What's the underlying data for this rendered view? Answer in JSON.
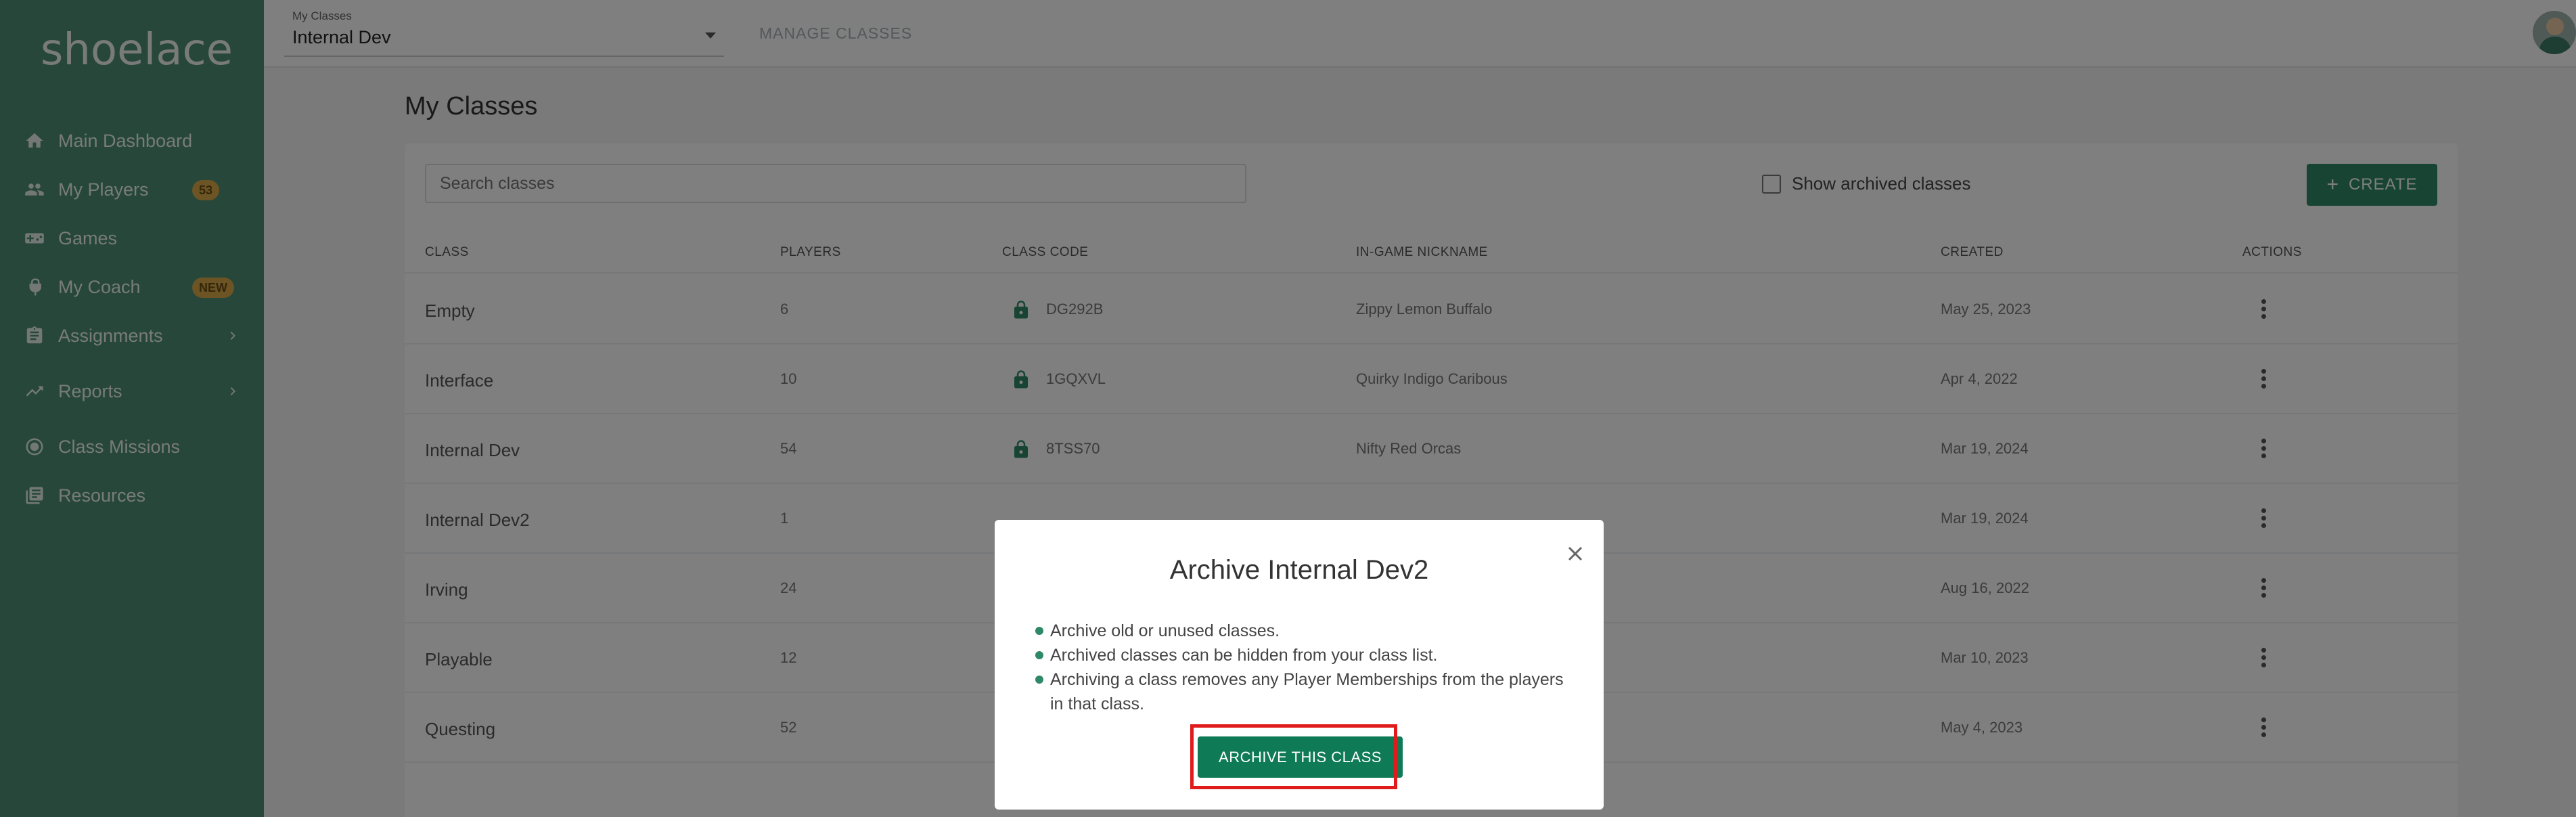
{
  "sidebar": {
    "logo": "shoelace",
    "items": [
      {
        "label": "Main Dashboard",
        "icon": "home-icon"
      },
      {
        "label": "My Players",
        "icon": "people-icon",
        "badge": "53"
      },
      {
        "label": "Games",
        "icon": "gamepad-icon"
      },
      {
        "label": "My Coach",
        "icon": "coach-icon",
        "badge": "NEW"
      },
      {
        "label": "Assignments",
        "icon": "clipboard-icon",
        "chevron": true
      },
      {
        "label": "Reports",
        "icon": "trend-icon",
        "chevron": true
      },
      {
        "label": "Class Missions",
        "icon": "target-icon"
      },
      {
        "label": "Resources",
        "icon": "library-icon"
      }
    ]
  },
  "topbar": {
    "class_select_label": "My Classes",
    "class_select_value": "Internal Dev",
    "manage_link": "MANAGE CLASSES"
  },
  "main": {
    "title": "My Classes",
    "search_placeholder": "Search classes",
    "show_archived_label": "Show archived classes",
    "create_label": "CREATE",
    "columns": [
      "CLASS",
      "PLAYERS",
      "CLASS CODE",
      "IN-GAME NICKNAME",
      "CREATED",
      "ACTIONS"
    ],
    "rows": [
      {
        "class": "Empty",
        "players": "6",
        "code": "DG292B",
        "nickname": "Zippy Lemon Buffalo",
        "created": "May 25, 2023"
      },
      {
        "class": "Interface",
        "players": "10",
        "code": "1GQXVL",
        "nickname": "Quirky Indigo Caribous",
        "created": "Apr 4, 2022"
      },
      {
        "class": "Internal Dev",
        "players": "54",
        "code": "8TSS70",
        "nickname": "Nifty Red Orcas",
        "created": "Mar 19, 2024"
      },
      {
        "class": "Internal Dev2",
        "players": "1",
        "code": "",
        "nickname": "",
        "created": "Mar 19, 2024"
      },
      {
        "class": "Irving",
        "players": "24",
        "code": "",
        "nickname": "",
        "created": "Aug 16, 2022"
      },
      {
        "class": "Playable",
        "players": "12",
        "code": "",
        "nickname": "",
        "created": "Mar 10, 2023"
      },
      {
        "class": "Questing",
        "players": "52",
        "code": "",
        "nickname": "",
        "created": "May 4, 2023"
      }
    ]
  },
  "modal": {
    "title": "Archive Internal Dev2",
    "bullets": [
      "Archive old or unused classes.",
      "Archived classes can be hidden from your class list.",
      "Archiving a class removes any Player Memberships from the players in that class."
    ],
    "confirm_label": "ARCHIVE THIS CLASS"
  },
  "colors": {
    "sidebar": "#4c8f75",
    "primary": "#2f8866",
    "highlight": "#e01b1b"
  }
}
